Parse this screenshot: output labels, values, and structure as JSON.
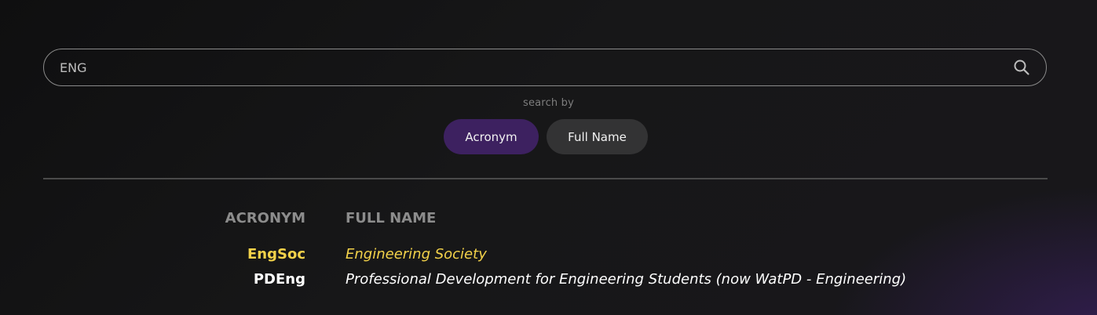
{
  "search": {
    "value": "ENG",
    "placeholder": ""
  },
  "search_by": {
    "label": "search by",
    "options": [
      {
        "label": "Acronym",
        "active": true
      },
      {
        "label": "Full Name",
        "active": false
      }
    ]
  },
  "table": {
    "headers": {
      "acronym": "ACRONYM",
      "full_name": "FULL NAME"
    },
    "rows": [
      {
        "acronym": "EngSoc",
        "full_name": "Engineering Society",
        "highlighted": true
      },
      {
        "acronym": "PDEng",
        "full_name": "Professional Development for Engineering Students (now WatPD - Engineering)",
        "highlighted": false
      }
    ]
  },
  "colors": {
    "accent_purple": "#3d2160",
    "highlight_yellow": "#f3d24a",
    "inactive_button": "#333334"
  },
  "icons": {
    "search": "search-icon"
  }
}
